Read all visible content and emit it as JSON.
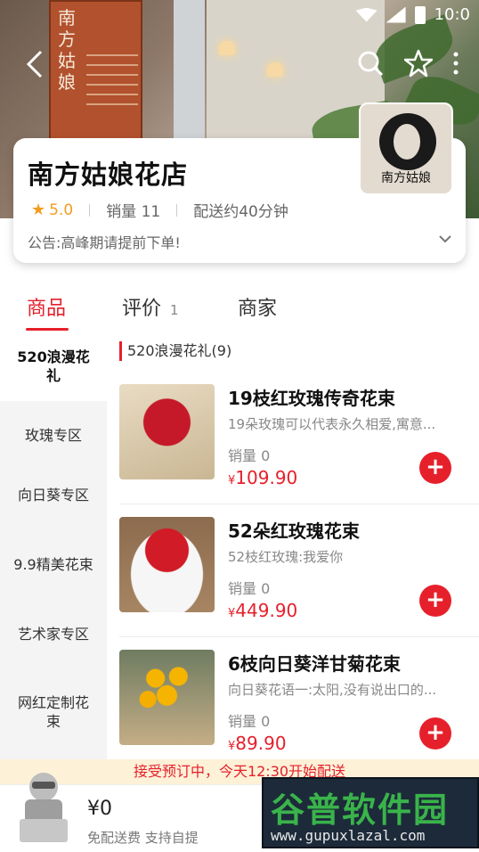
{
  "status_bar": {
    "time": "10:0"
  },
  "hero": {
    "sign_text": "南方姑娘"
  },
  "store": {
    "name": "南方姑娘花店",
    "logo_text": "南方姑娘",
    "rating": "5.0",
    "sales": "销量 11",
    "delivery_time": "配送约40分钟",
    "notice": "公告:高峰期请提前下单!"
  },
  "tabs": [
    {
      "label": "商品",
      "active": true
    },
    {
      "label": "评价",
      "count": "1"
    },
    {
      "label": "商家"
    }
  ],
  "sidebar": {
    "items": [
      {
        "label": "520浪漫花礼",
        "active": true
      },
      {
        "label": "玫瑰专区"
      },
      {
        "label": "向日葵专区"
      },
      {
        "label": "9.9精美花束"
      },
      {
        "label": "艺术家专区"
      },
      {
        "label": "网红定制花束"
      }
    ]
  },
  "section": {
    "title": "520浪漫花礼(9)"
  },
  "products": [
    {
      "name": "19枝红玫瑰传奇花束",
      "desc": "19朵玫瑰可以代表永久相爱,寓意...",
      "sales": "销量 0",
      "currency": "¥",
      "price": "109.90"
    },
    {
      "name": "52朵红玫瑰花束",
      "desc": "52枝红玫瑰:我爱你",
      "sales": "销量 0",
      "currency": "¥",
      "price": "449.90"
    },
    {
      "name": "6枝向日葵洋甘菊花束",
      "desc": "向日葵花语一:太阳,没有说出口的...",
      "sales": "销量 0",
      "currency": "¥",
      "price": "89.90"
    }
  ],
  "add_symbol": "+",
  "preorder_banner": "接受预订中，今天12:30开始配送",
  "cart": {
    "total": "¥0",
    "delivery_note": "免配送费  支持自提"
  },
  "watermark": {
    "main": "谷普软件园",
    "sub": "www.gupuxlazal.com"
  },
  "colors": {
    "accent": "#e6202b",
    "rating": "#f29c1f"
  }
}
